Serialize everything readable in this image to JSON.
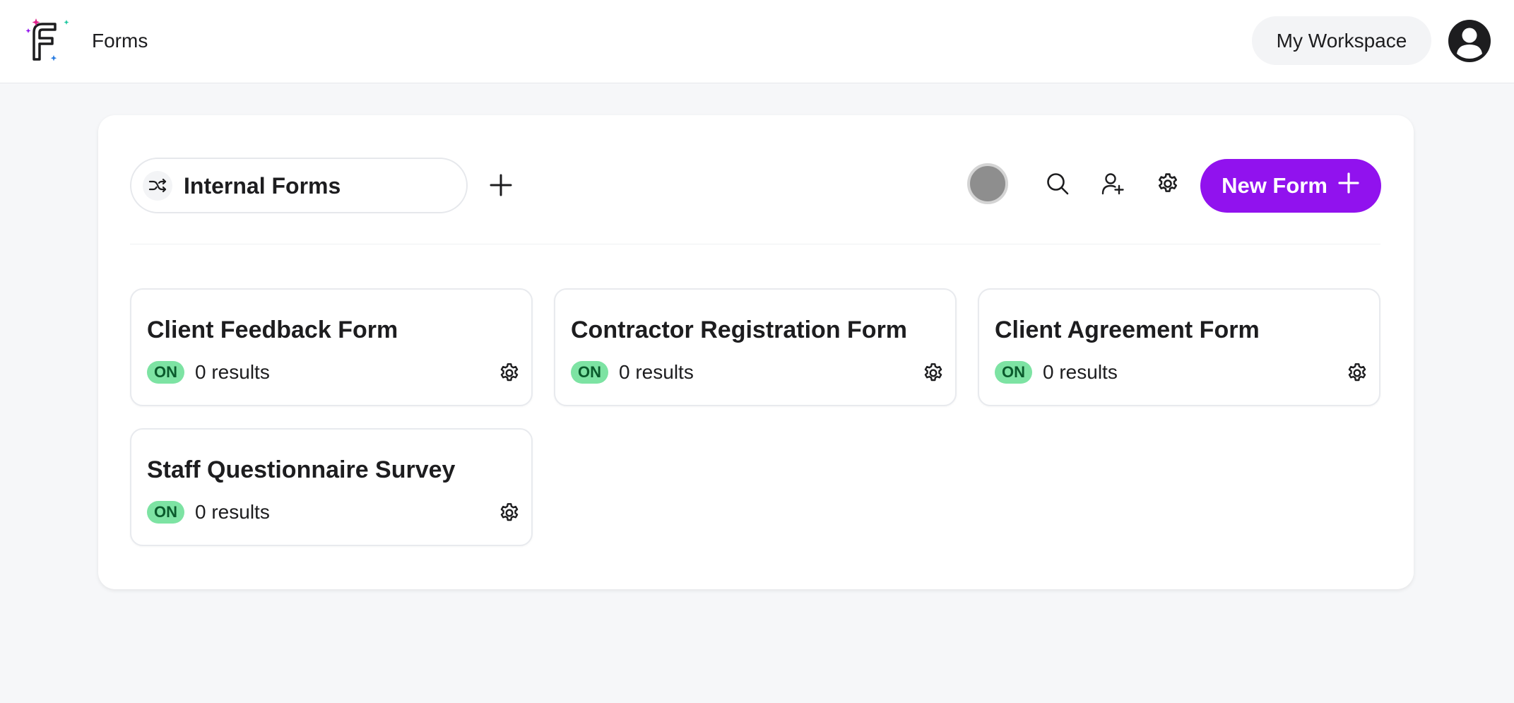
{
  "app": {
    "title": "Forms",
    "workspace_label": "My Workspace"
  },
  "toolbar": {
    "folder_name": "Internal Forms",
    "new_form_label": "New Form"
  },
  "forms": [
    {
      "title": "Client Feedback Form",
      "status": "ON",
      "results": "0 results"
    },
    {
      "title": "Contractor Registration Form",
      "status": "ON",
      "results": "0 results"
    },
    {
      "title": "Client Agreement Form",
      "status": "ON",
      "results": "0 results"
    },
    {
      "title": "Staff Questionnaire Survey",
      "status": "ON",
      "results": "0 results"
    }
  ],
  "icons": {
    "logo": "forms-logo-icon",
    "avatar": "user-avatar-icon",
    "shuffle": "shuffle-icon",
    "add": "plus-icon",
    "search": "search-icon",
    "invite": "add-user-icon",
    "settings": "gear-icon"
  },
  "colors": {
    "accent": "#9112ee",
    "status_on_bg": "#7de3a3",
    "status_on_text": "#0a5a2c",
    "indicator": "#8e8e8e",
    "page_bg": "#f6f7f9"
  }
}
